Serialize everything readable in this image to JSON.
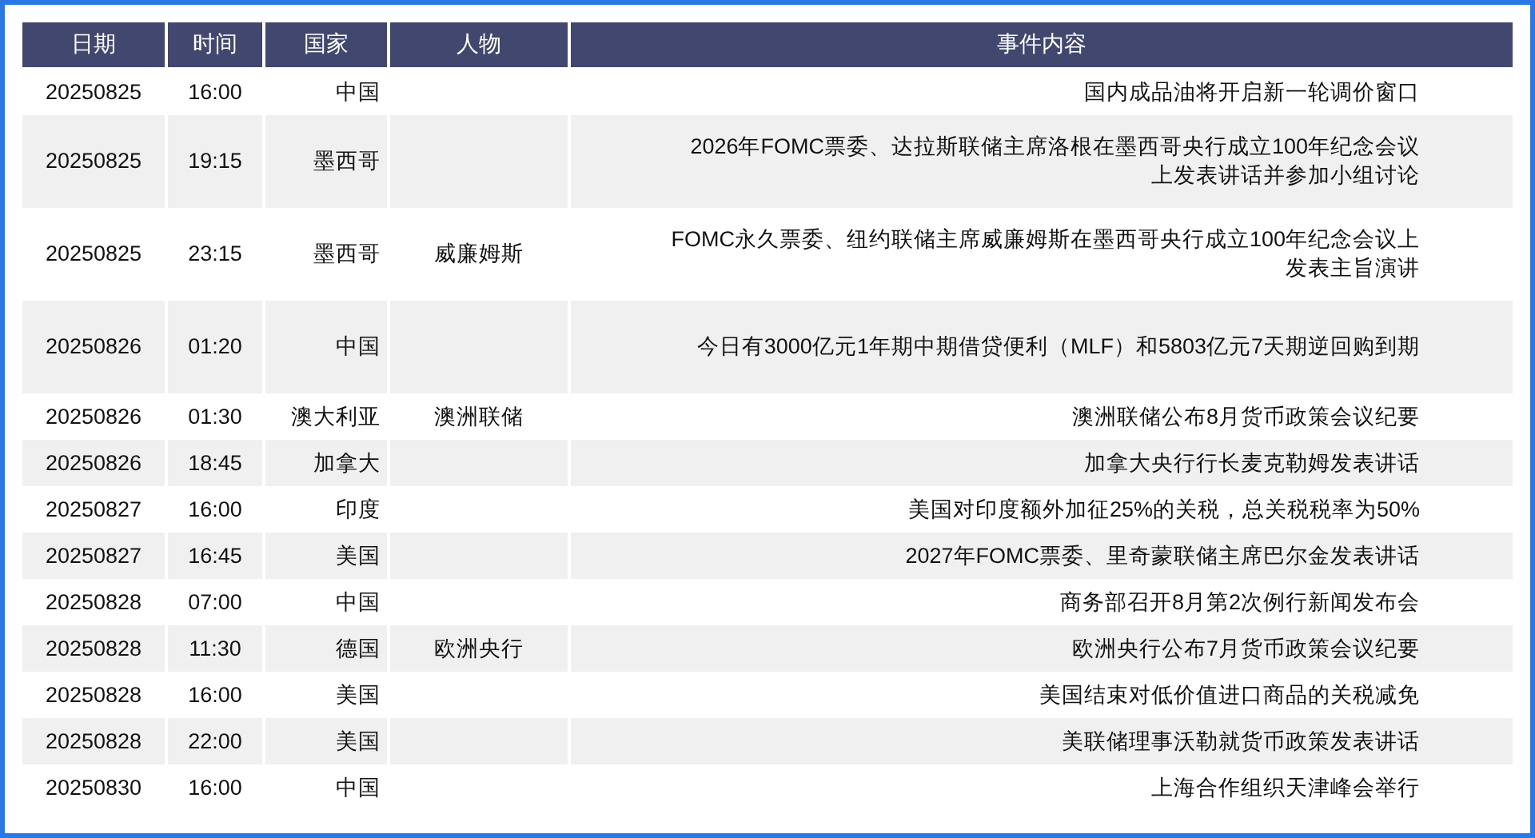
{
  "table": {
    "columns": [
      "日期",
      "时间",
      "国家",
      "人物",
      "事件内容"
    ],
    "rows": [
      [
        "20250825",
        "16:00",
        "中国",
        "",
        "国内成品油将开启新一轮调价窗口"
      ],
      [
        "20250825",
        "19:15",
        "墨西哥",
        "",
        "2026年FOMC票委、达拉斯联储主席洛根在墨西哥央行成立100年纪念会议上发表讲话并参加小组讨论"
      ],
      [
        "20250825",
        "23:15",
        "墨西哥",
        "威廉姆斯",
        "FOMC永久票委、纽约联储主席威廉姆斯在墨西哥央行成立100年纪念会议上发表主旨演讲"
      ],
      [
        "20250826",
        "01:20",
        "中国",
        "",
        "今日有3000亿元1年期中期借贷便利（MLF）和5803亿元7天期逆回购到期"
      ],
      [
        "20250826",
        "01:30",
        "澳大利亚",
        "澳洲联储",
        "澳洲联储公布8月货币政策会议纪要"
      ],
      [
        "20250826",
        "18:45",
        "加拿大",
        "",
        "加拿大央行行长麦克勒姆发表讲话"
      ],
      [
        "20250827",
        "16:00",
        "印度",
        "",
        "美国对印度额外加征25%的关税，总关税税率为50%"
      ],
      [
        "20250827",
        "16:45",
        "美国",
        "",
        "2027年FOMC票委、里奇蒙联储主席巴尔金发表讲话"
      ],
      [
        "20250828",
        "07:00",
        "中国",
        "",
        "商务部召开8月第2次例行新闻发布会"
      ],
      [
        "20250828",
        "11:30",
        "德国",
        "欧洲央行",
        "欧洲央行公布7月货币政策会议纪要"
      ],
      [
        "20250828",
        "16:00",
        "美国",
        "",
        "美国结束对低价值进口商品的关税减免"
      ],
      [
        "20250828",
        "22:00",
        "美国",
        "",
        "美联储理事沃勒就货币政策发表讲话"
      ],
      [
        "20250830",
        "16:00",
        "中国",
        "",
        "上海合作组织天津峰会举行"
      ]
    ]
  }
}
